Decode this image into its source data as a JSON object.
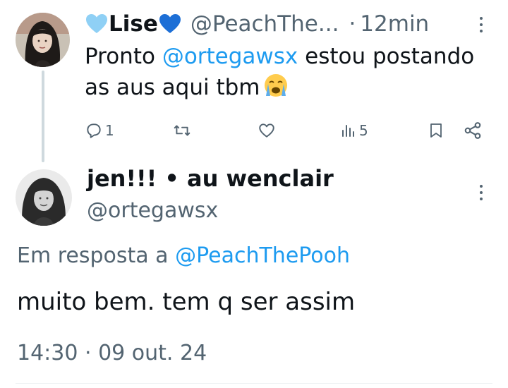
{
  "reply": {
    "display_name": "Lise",
    "handle": "@PeachThe...",
    "separator": "·",
    "time": "12min",
    "text_before": "Pronto ",
    "mention": "@ortegawsx",
    "text_after": " estou postando as aus aqui tbm",
    "stats": {
      "replies": "1",
      "views": "5"
    }
  },
  "main": {
    "display_name": "jen!!! • au wenclair",
    "handle": "@ortegawsx",
    "reply_prefix": "Em resposta a ",
    "reply_to": "@PeachThePooh",
    "text": "muito bem. tem q ser assim",
    "timestamp": "14:30 · 09 out. 24"
  },
  "icons": {
    "reply": "comment-icon",
    "retweet": "retweet-icon",
    "like": "heart-outline-icon",
    "views": "views-chart-icon",
    "bookmark": "bookmark-icon",
    "share": "share-icon",
    "more": "more-vertical-icon",
    "emoji_heart": "blue-heart-emoji",
    "emoji_sob": "loudly-crying-emoji"
  },
  "colors": {
    "link": "#1d9bf0",
    "secondary_text": "#536471",
    "primary_text": "#0f1419",
    "heart_emoji": "#5ab4f0"
  }
}
